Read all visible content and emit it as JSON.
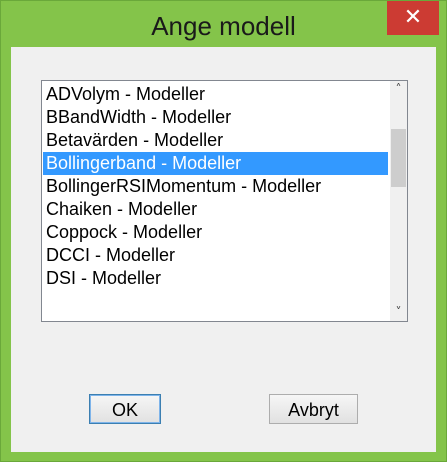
{
  "window": {
    "title": "Ange modell",
    "close_label": "✕"
  },
  "list": {
    "items": [
      {
        "label": "ADVolym - Modeller",
        "selected": false
      },
      {
        "label": "BBandWidth - Modeller",
        "selected": false
      },
      {
        "label": "Betavärden - Modeller",
        "selected": false
      },
      {
        "label": "Bollingerband - Modeller",
        "selected": true
      },
      {
        "label": "BollingerRSIMomentum - Modeller",
        "selected": false
      },
      {
        "label": "Chaiken - Modeller",
        "selected": false
      },
      {
        "label": "Coppock - Modeller",
        "selected": false
      },
      {
        "label": "DCCI - Modeller",
        "selected": false
      },
      {
        "label": "DSI - Modeller",
        "selected": false
      }
    ],
    "scroll_up_icon": "chevron-up-icon",
    "scroll_down_icon": "chevron-down-icon"
  },
  "buttons": {
    "ok_label": "OK",
    "cancel_label": "Avbryt"
  },
  "colors": {
    "titlebar": "#84c44a",
    "close": "#cc3b33",
    "selection": "#3399ff"
  }
}
